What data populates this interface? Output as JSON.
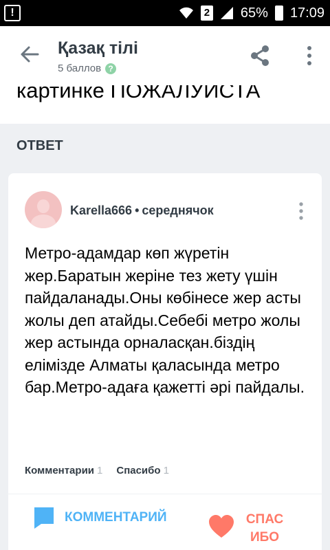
{
  "status_bar": {
    "sim": "2",
    "battery": "65%",
    "time": "17:09"
  },
  "header": {
    "title": "Қазақ тілі",
    "points": "5 баллов"
  },
  "question": {
    "tail": "картинке ПОЖАЛУИСТА"
  },
  "answer_section": {
    "heading": "ОТВЕТ"
  },
  "answer": {
    "author": "Karella666",
    "separator": "•",
    "rank": "середнячок",
    "text": "Метро-адамдар көп жүретін жер.Баратын жеріне тез жету үшін пайдаланады.Оны көбінесе жер асты жолы деп атайды.Себебі метро жолы жер астында орналасқан.біздің елімізде Алматы қаласында метро бар.Метро-адаға қажетті әрі пайдалы.",
    "comments_label": "Комментарии",
    "comments_count": "1",
    "thanks_label": "Спасибо",
    "thanks_count": "1"
  },
  "actions": {
    "comment": "КОММЕНТАРИЙ",
    "thanks": "СПАСИБО"
  },
  "colors": {
    "accent_blue": "#4fb3f6",
    "accent_red": "#ff7968",
    "help_green": "#8fd3a7"
  }
}
